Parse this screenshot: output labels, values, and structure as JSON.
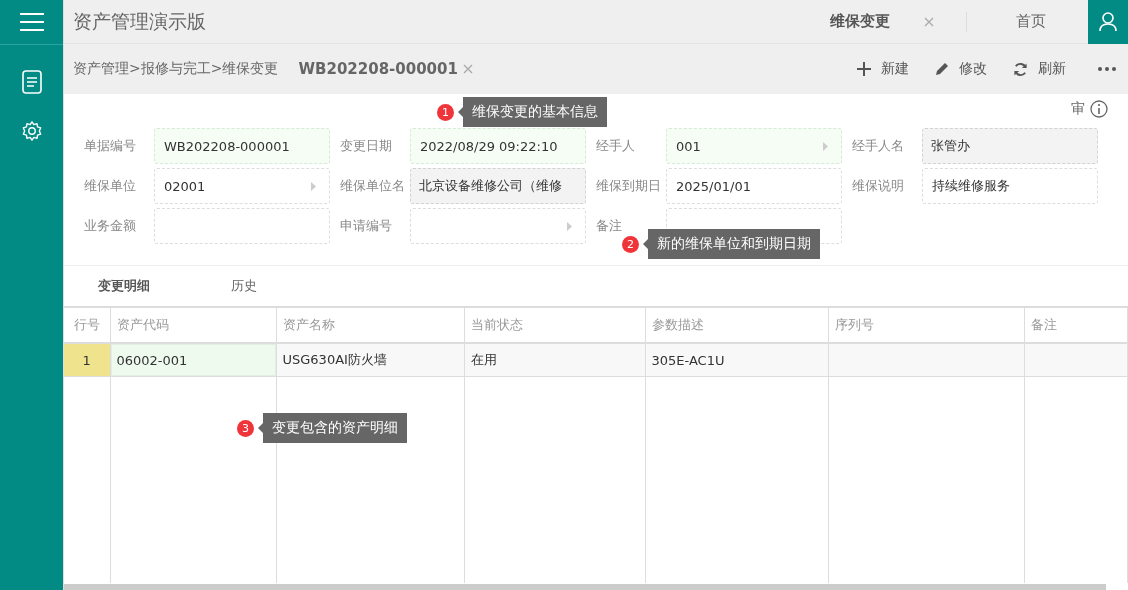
{
  "app": {
    "title": "资产管理演示版"
  },
  "top_tabs": [
    {
      "label": "维保变更",
      "selected": true,
      "closable": true
    },
    {
      "label": "首页",
      "selected": false,
      "closable": false
    }
  ],
  "breadcrumb": "资产管理>报修与完工>维保变更",
  "document_tab": {
    "label": "WB202208-000001"
  },
  "toolbar": [
    {
      "kind": "new",
      "label": "新建"
    },
    {
      "kind": "edit",
      "label": "修改"
    },
    {
      "kind": "refresh",
      "label": "刷新"
    },
    {
      "kind": "more"
    }
  ],
  "audit_label": "审",
  "form_fields": [
    {
      "label": "单据编号",
      "value": "WB202208-000001",
      "kind": "text",
      "required": true,
      "readonly": false
    },
    {
      "label": "变更日期",
      "value": "2022/08/29 09:22:10",
      "kind": "text",
      "required": true,
      "readonly": false
    },
    {
      "label": "经手人",
      "value": "001",
      "kind": "lookup",
      "required": true,
      "readonly": false
    },
    {
      "label": "经手人名",
      "value": "张管办",
      "kind": "text",
      "required": false,
      "readonly": true
    },
    {
      "label": "维保单位",
      "value": "02001",
      "kind": "lookup",
      "required": false,
      "readonly": false
    },
    {
      "label": "维保单位名",
      "value": "北京设备维修公司（维修",
      "kind": "text",
      "required": false,
      "readonly": true
    },
    {
      "label": "维保到期日",
      "value": "2025/01/01",
      "kind": "text",
      "required": false,
      "readonly": false
    },
    {
      "label": "维保说明",
      "value": "持续维修服务",
      "kind": "text",
      "required": false,
      "readonly": false
    },
    {
      "label": "业务金额",
      "kind": "text",
      "required": false,
      "readonly": false
    },
    {
      "label": "申请编号",
      "kind": "lookup",
      "required": false,
      "readonly": false
    },
    {
      "label": "备注",
      "kind": "text",
      "required": false,
      "readonly": false
    }
  ],
  "detail_tabs": [
    {
      "label": "变更明细",
      "selected": true
    },
    {
      "label": "历史",
      "selected": false
    }
  ],
  "table": {
    "columns": [
      "行号",
      "资产代码",
      "资产名称",
      "当前状态",
      "参数描述",
      "序列号",
      "备注"
    ],
    "rows": [
      {
        "selected": true,
        "cells": [
          {
            "text": "1",
            "focused": false
          },
          {
            "text": "06002-001",
            "focused": true
          },
          {
            "text": "USG630AI防火墙",
            "focused": false
          },
          {
            "text": "在用",
            "focused": false
          },
          {
            "text": "305E-AC1U",
            "focused": false
          },
          {
            "focused": false
          },
          {
            "focused": false
          }
        ]
      }
    ]
  },
  "callouts": [
    {
      "number": "1",
      "text": "维保变更的基本信息"
    },
    {
      "number": "2",
      "text": "新的维保单位和到期日期"
    },
    {
      "number": "3",
      "text": "变更包含的资产明细"
    }
  ]
}
